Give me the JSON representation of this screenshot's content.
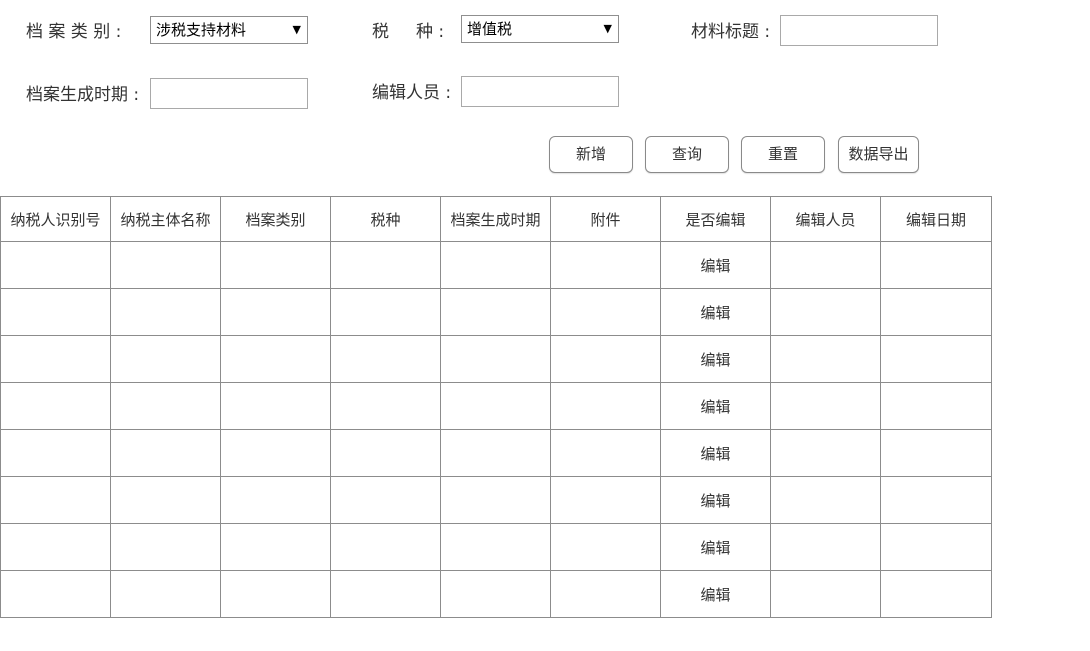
{
  "filters": {
    "archive_type": {
      "label": "档 案 类 别 :",
      "value": "涉税支持材料"
    },
    "tax_type": {
      "label": "税     种 :",
      "value": "增值税"
    },
    "material_title": {
      "label": "材料标题 :",
      "value": "",
      "placeholder": ""
    },
    "archive_date": {
      "label": "档案生成时期 :",
      "value": "",
      "placeholder": ""
    },
    "editor": {
      "label": "编辑人员 :",
      "value": "",
      "placeholder": ""
    }
  },
  "buttons": {
    "add": "新增",
    "query": "查询",
    "reset": "重置",
    "export": "数据导出"
  },
  "table": {
    "columns": [
      "纳税人识别号",
      "纳税主体名称",
      "档案类别",
      "税种",
      "档案生成时期",
      "附件",
      "是否编辑",
      "编辑人员",
      "编辑日期"
    ],
    "rows": [
      {
        "edit": "编辑"
      },
      {
        "edit": "编辑"
      },
      {
        "edit": "编辑"
      },
      {
        "edit": "编辑"
      },
      {
        "edit": "编辑"
      },
      {
        "edit": "编辑"
      },
      {
        "edit": "编辑"
      },
      {
        "edit": "编辑"
      }
    ]
  }
}
